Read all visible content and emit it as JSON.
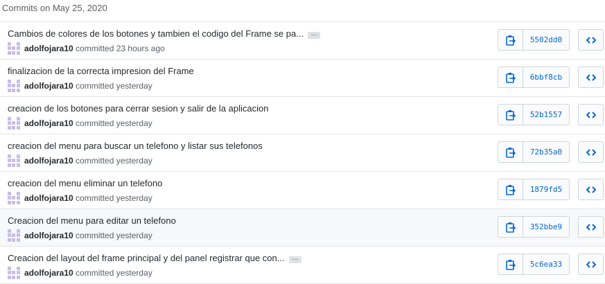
{
  "header": {
    "date_label": "Commits on May 25, 2020"
  },
  "commits": [
    {
      "message": "Cambios de colores de los botones y tambien el codigo del Frame se pa...",
      "has_ellipsis": true,
      "author": "adolfojara10",
      "action": "committed",
      "time": "23 hours ago",
      "sha": "5502dd0",
      "highlighted": false
    },
    {
      "message": "finalizacion de la correcta impresion del Frame",
      "has_ellipsis": false,
      "author": "adolfojara10",
      "action": "committed",
      "time": "yesterday",
      "sha": "6bbf8cb",
      "highlighted": false
    },
    {
      "message": "creacion de los botones para cerrar sesion y salir de la aplicacion",
      "has_ellipsis": false,
      "author": "adolfojara10",
      "action": "committed",
      "time": "yesterday",
      "sha": "52b1557",
      "highlighted": false
    },
    {
      "message": "creacion del menu para buscar un telefono y listar sus telefonos",
      "has_ellipsis": false,
      "author": "adolfojara10",
      "action": "committed",
      "time": "yesterday",
      "sha": "72b35a0",
      "highlighted": false
    },
    {
      "message": "creacion del menu eliminar un telefono",
      "has_ellipsis": false,
      "author": "adolfojara10",
      "action": "committed",
      "time": "yesterday",
      "sha": "1879fd5",
      "highlighted": false
    },
    {
      "message": "Creacion del menu para editar un telefono",
      "has_ellipsis": false,
      "author": "adolfojara10",
      "action": "committed",
      "time": "yesterday",
      "sha": "352bbe9",
      "highlighted": true
    },
    {
      "message": "Creacion del layout del frame principal y del panel registrar que con...",
      "has_ellipsis": true,
      "author": "adolfojara10",
      "action": "committed",
      "time": "yesterday",
      "sha": "5c6ea33",
      "highlighted": false
    }
  ],
  "icons": {
    "copy": "clipboard-icon",
    "browse": "code-brackets-icon",
    "ellipsis": "ellipsis-icon"
  },
  "colors": {
    "sha_link": "#0366d6",
    "avatar": "#c7bde8",
    "icon": "#0366d6",
    "highlight_row": "#f6f8fa"
  }
}
